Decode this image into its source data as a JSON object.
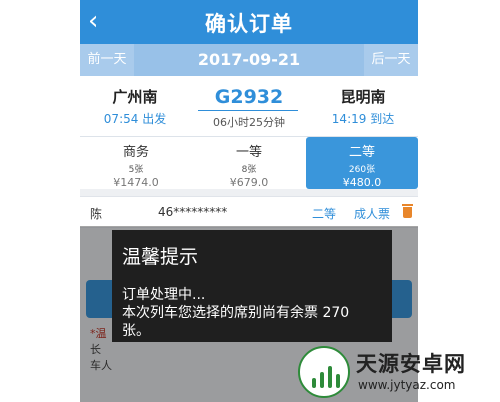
{
  "header": {
    "back_icon": "‹",
    "title": "确认订单"
  },
  "datebar": {
    "prev": "前一天",
    "date": "2017-09-21",
    "next": "后一天"
  },
  "train": {
    "from": {
      "name": "广州南",
      "time": "07:54 出发"
    },
    "to": {
      "name": "昆明南",
      "time": "14:19 到达"
    },
    "number": "G2932",
    "duration": "06小时25分钟"
  },
  "seats": [
    {
      "cls": "商务",
      "count": "5张",
      "price": "¥1474.0",
      "selected": false
    },
    {
      "cls": "一等",
      "count": "8张",
      "price": "¥679.0",
      "selected": false
    },
    {
      "cls": "二等",
      "count": "260张",
      "price": "¥480.0",
      "selected": true
    }
  ],
  "passenger": {
    "name": "陈",
    "id": "46*********",
    "class": "二等",
    "ticket_type": "成人票"
  },
  "background_note": {
    "line1": "*温",
    "line2": "长",
    "line3": "车人"
  },
  "dialog": {
    "title": "温馨提示",
    "message": "订单处理中...\n本次列车您选择的席别尚有余票 270\n张。"
  },
  "watermark": {
    "title": "天源安卓网",
    "url": "www.jytyaz.com"
  },
  "colors": {
    "primary": "#2f8ed9",
    "dialog_bg": "#1f1f1f",
    "watermark_green": "#2e8b3a"
  }
}
